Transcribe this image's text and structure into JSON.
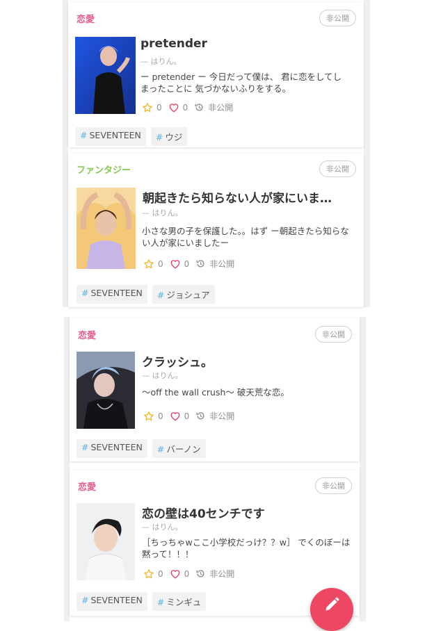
{
  "stories": [
    {
      "category": "恋愛",
      "visibility": "非公開",
      "title": "pretender",
      "author": "— はりん。",
      "description": "ー pretender ー 今日だって僕は、 君に恋をしてしまったことに 気づかないふりをする。",
      "stars": "0",
      "likes": "0",
      "status": "非公開",
      "tags": [
        "SEVENTEEN",
        "ウジ"
      ]
    },
    {
      "category": "ファンタジー",
      "visibility": "非公開",
      "title": "朝起きたら知らない人が家にいま…",
      "author": "— はりん。",
      "description": "小さな男の子を保護した。。はず ー朝起きたら知らない人が家にいましたー",
      "stars": "0",
      "likes": "0",
      "status": "非公開",
      "tags": [
        "SEVENTEEN",
        "ジョシュア"
      ]
    },
    {
      "category": "恋愛",
      "visibility": "非公開",
      "title": "クラッシュ。",
      "author": "— はりん。",
      "description": "〜off the wall crush〜 破天荒な恋。",
      "stars": "0",
      "likes": "0",
      "status": "非公開",
      "tags": [
        "SEVENTEEN",
        "バーノン"
      ]
    },
    {
      "category": "恋愛",
      "visibility": "非公開",
      "title": "恋の壁は40センチです",
      "author": "— はりん。",
      "description": "［ちっちゃwここ小学校だっけ？？w］ でくのぼーは黙って！！！",
      "stars": "0",
      "likes": "0",
      "status": "非公開",
      "tags": [
        "SEVENTEEN",
        "ミンギュ"
      ]
    }
  ],
  "colors": {
    "category_love": "#e85a86",
    "category_fantasy": "#86c84c",
    "star": "#f2b72a",
    "heart": "#e63a5e",
    "tag_hash": "#5bb1e4",
    "fab": "#ee4763"
  },
  "icons": {
    "star": "star-icon",
    "heart": "heart-icon",
    "status": "history-icon",
    "fab": "pencil-icon"
  }
}
